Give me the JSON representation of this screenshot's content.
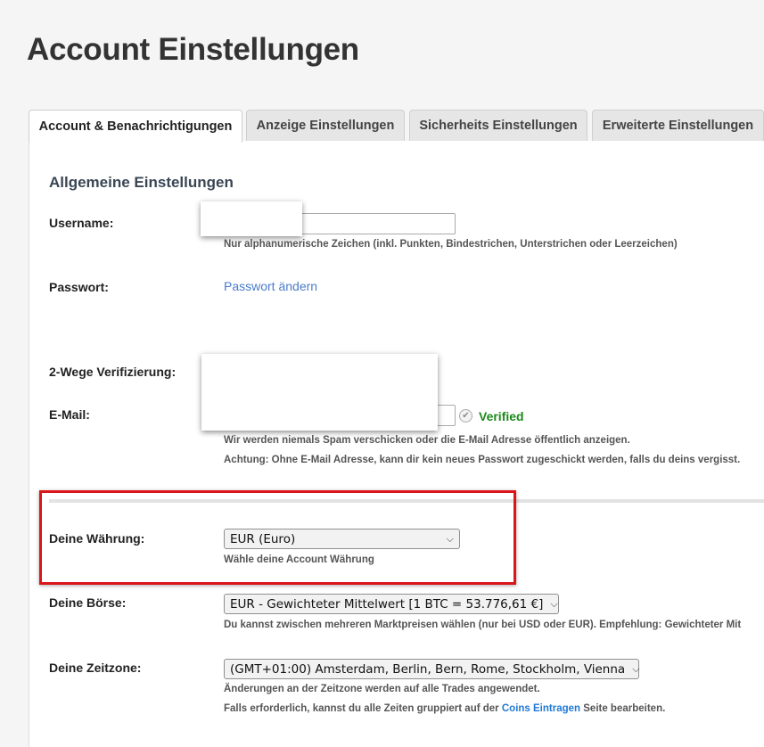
{
  "page": {
    "title": "Account Einstellungen"
  },
  "tabs": [
    {
      "label": "Account & Benachrichtigungen",
      "active": true
    },
    {
      "label": "Anzeige Einstellungen",
      "active": false
    },
    {
      "label": "Sicherheits Einstellungen",
      "active": false
    },
    {
      "label": "Erweiterte Einstellungen",
      "active": false
    }
  ],
  "general": {
    "heading": "Allgemeine Einstellungen",
    "username": {
      "label": "Username:",
      "value": "",
      "hint": "Nur alphanumerische Zeichen (inkl. Punkten, Bindestrichen, Unterstrichen oder Leerzeichen)"
    },
    "password": {
      "label": "Passwort:",
      "link": "Passwort ändern"
    },
    "two_factor": {
      "label": "2-Wege Verifizierung:"
    },
    "email": {
      "label": "E-Mail:",
      "value": "",
      "status": "Verified",
      "hint1": "Wir werden niemals Spam verschicken oder die E-Mail Adresse öffentlich anzeigen.",
      "hint2": "Achtung: Ohne E-Mail Adresse, kann dir kein neues Passwort zugeschickt werden, falls du deins vergisst."
    }
  },
  "currency": {
    "label": "Deine Währung:",
    "selected": "EUR (Euro)",
    "hint": "Wähle deine Account Währung"
  },
  "exchange": {
    "label": "Deine Börse:",
    "selected": "EUR - Gewichteter Mittelwert [1 BTC = 53.776,61 €]",
    "hint": "Du kannst zwischen mehreren Marktpreisen wählen (nur bei USD oder EUR). Empfehlung: Gewichteter Mit"
  },
  "timezone": {
    "label": "Deine Zeitzone:",
    "selected": "(GMT+01:00) Amsterdam, Berlin, Bern, Rome, Stockholm, Vienna",
    "hint1": "Änderungen an der Zeitzone werden auf alle Trades angewendet.",
    "hint2_pre": "Falls erforderlich, kannst du alle Zeiten gruppiert auf der",
    "hint2_link": "Coins Eintragen",
    "hint2_post": "Seite bearbeiten."
  },
  "icons": {
    "chevron": "chevron-down-icon",
    "verified": "check-circle-icon"
  },
  "colors": {
    "highlight": "#d9171b",
    "link": "#4a7cc9",
    "verified": "#1a8a1a"
  }
}
